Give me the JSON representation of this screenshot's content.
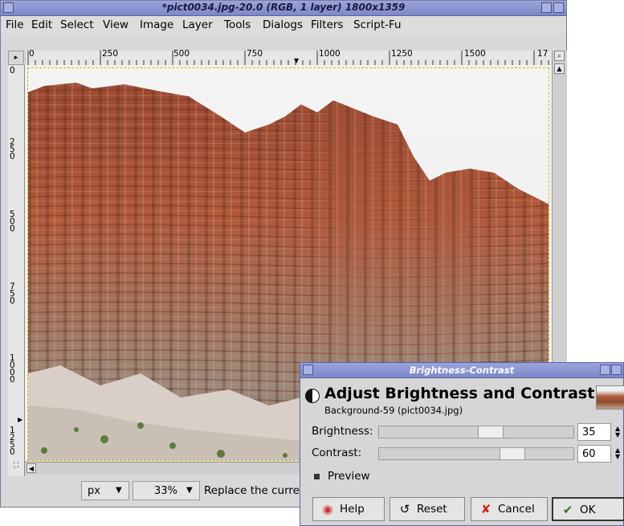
{
  "image_window": {
    "title": "*pict0034.jpg-20.0 (RGB, 1 layer) 1800x1359",
    "menu": [
      "File",
      "Edit",
      "Select",
      "View",
      "Image",
      "Layer",
      "Tools",
      "Dialogs",
      "Filters",
      "Script-Fu"
    ],
    "hruler_labels": [
      "0",
      "250",
      "500",
      "750",
      "1000",
      "1250",
      "1500",
      "17"
    ],
    "vruler_labels": [
      "0",
      "250",
      "500",
      "750",
      "1000",
      "1250"
    ],
    "unit": "px",
    "zoom": "33%",
    "status_message": "Replace the curren"
  },
  "dialog": {
    "window_title": "Brightness-Contrast",
    "heading": "Adjust Brightness and Contrast",
    "subtitle": "Background-59 (pict0034.jpg)",
    "brightness_label": "Brightness:",
    "brightness_value": "35",
    "contrast_label": "Contrast:",
    "contrast_value": "60",
    "preview_label": "Preview",
    "buttons": {
      "help": "Help",
      "reset": "Reset",
      "cancel": "Cancel",
      "ok": "OK"
    },
    "brightness_fraction": 0.5735,
    "contrast_fraction": 0.7
  },
  "colors": {
    "titlebar": "#8c96d4",
    "rock": "#a85a3c",
    "selection_border": "#d1b300"
  }
}
